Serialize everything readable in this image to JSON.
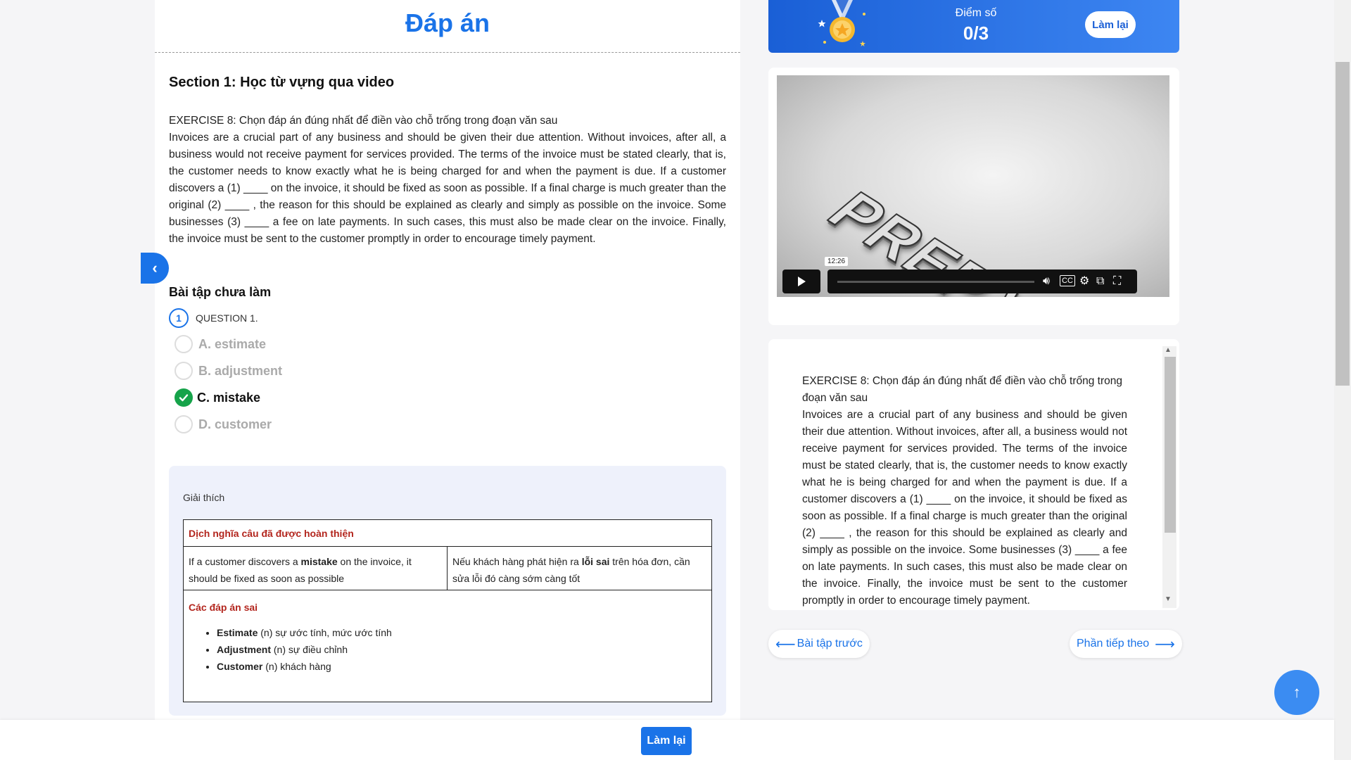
{
  "page": {
    "title": "Đáp án",
    "section_title": "Section 1: Học từ vựng qua video"
  },
  "exercise": {
    "title": "EXERCISE 8: Chọn đáp án đúng nhất để điền vào chỗ trống trong đoạn văn sau",
    "passage": "Invoices are a crucial part of any business and should be given their due attention. Without invoices, after all, a business would not receive payment for services provided. The terms of the invoice must be stated clearly, that is, the customer needs to know exactly what he is being charged for and when the payment is due. If a customer discovers a (1) ____ on the invoice, it should be fixed as soon as possible. If a final charge is much greater than the original (2) ____ , the reason for this should be explained as clearly and simply as possible on the invoice. Some businesses (3) ____ a fee on late payments. In such cases, this must also be made clear on the invoice. Finally, the invoice must be sent to the customer promptly in order to encourage timely payment."
  },
  "questions": {
    "section_label": "Bài tập chưa làm",
    "number": "1",
    "label": "QUESTION 1.",
    "options": [
      {
        "text": "A. estimate",
        "state": "unselected"
      },
      {
        "text": "B. adjustment",
        "state": "unselected"
      },
      {
        "text": "C. mistake",
        "state": "correct"
      },
      {
        "text": "D. customer",
        "state": "unselected"
      }
    ]
  },
  "explanation": {
    "label": "Giải thích",
    "heading": "Dịch nghĩa câu đã được hoàn thiện",
    "en_pre": "If a customer discovers a ",
    "en_bold": "mistake",
    "en_post": " on the invoice, it should be fixed as soon as possible",
    "vi_pre": "Nếu khách hàng phát hiện ra ",
    "vi_bold": "lỗi sai",
    "vi_post": " trên hóa đơn, cần sửa lỗi đó càng sớm càng tốt",
    "wrong_heading": "Các đáp án sai",
    "wrong_items": [
      {
        "word": "Estimate",
        "meaning": " (n) sự ước tính, mức ước tính"
      },
      {
        "word": "Adjustment",
        "meaning": " (n) sự điều chỉnh"
      },
      {
        "word": "Customer",
        "meaning": " (n)  khách hàng"
      }
    ]
  },
  "score": {
    "label": "Điểm số",
    "value": "0/3",
    "retry_label": "Làm lại"
  },
  "video": {
    "logo_text": "PREP.VN",
    "time_tooltip": "12:26"
  },
  "navigation": {
    "prev_label": "Bài tập trước",
    "next_label": "Phần tiếp theo"
  },
  "footer": {
    "retry_label": "Làm lại"
  },
  "colors": {
    "accent": "#1a73e8",
    "correct": "#16a34a",
    "explain_heading": "#b3261e"
  }
}
